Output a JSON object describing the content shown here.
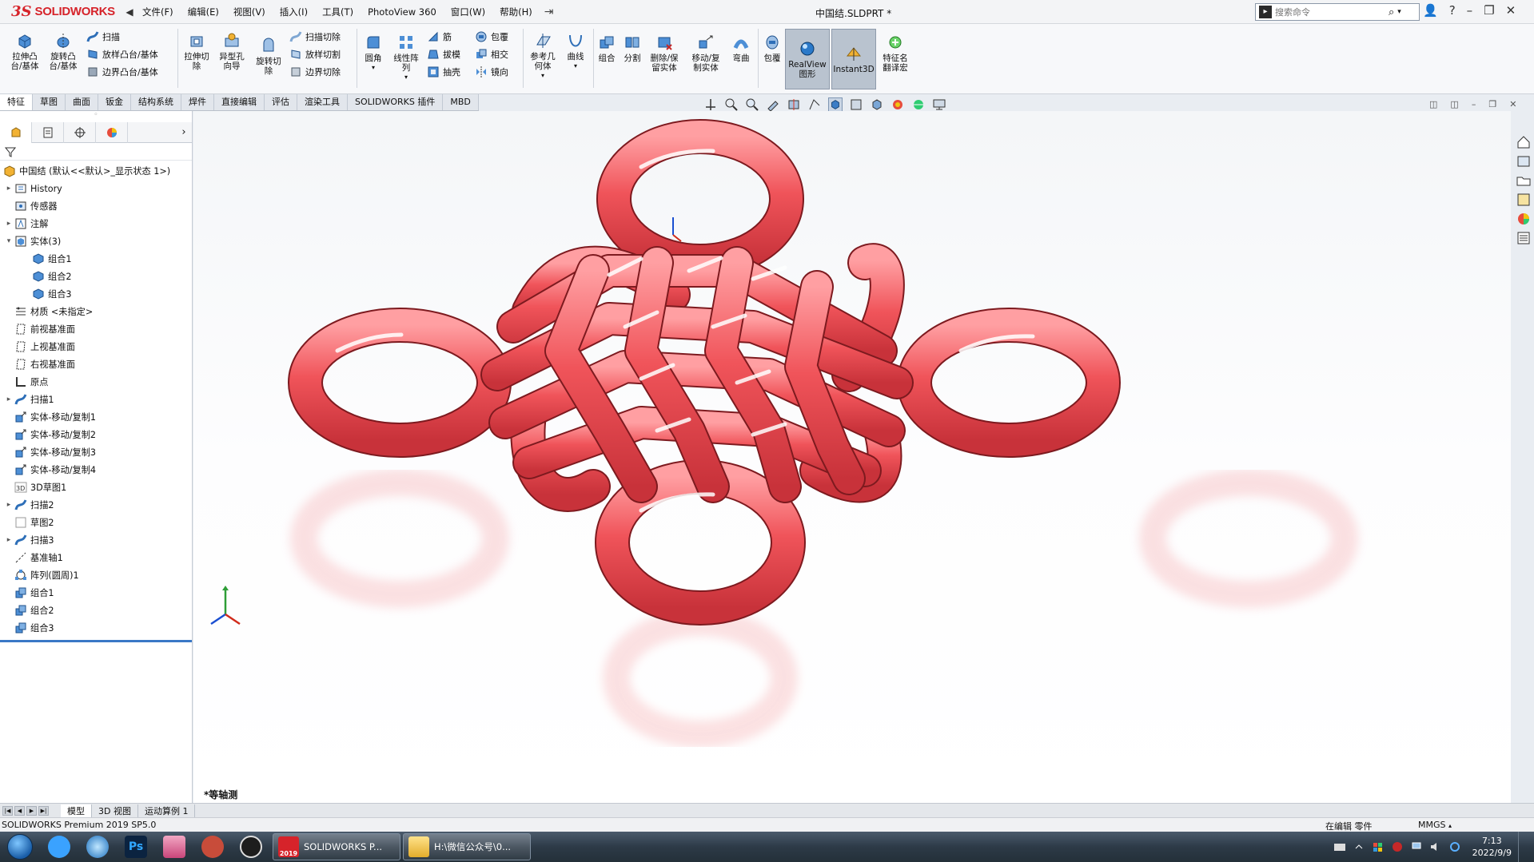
{
  "app": {
    "brand_ds": "3S",
    "brand_name": "SOLIDWORKS",
    "menus": [
      "文件(F)",
      "编辑(E)",
      "视图(V)",
      "插入(I)",
      "工具(T)",
      "PhotoView 360",
      "窗口(W)",
      "帮助(H)"
    ],
    "doc_title": "中国结.SLDPRT *",
    "search_placeholder": "搜索命令"
  },
  "ribbon": {
    "extrude_boss": "拉伸凸\n台/基体",
    "revolve_boss": "旋转凸\n台/基体",
    "sweep": "扫描",
    "loft_boss": "放样凸台/基体",
    "boundary_boss": "边界凸台/基体",
    "extrude_cut": "拉伸切\n除",
    "hole_wizard": "异型孔\n向导",
    "revolve_cut": "旋转切\n除",
    "swept_cut": "扫描切除",
    "lofted_cut": "放样切割",
    "boundary_cut": "边界切除",
    "fillet": "圆角",
    "linear_pattern": "线性阵\n列",
    "rib": "筋",
    "draft": "拔模",
    "shell": "抽壳",
    "wrap": "包覆",
    "intersect": "相交",
    "mirror": "镜向",
    "ref_geometry": "参考几\n何体",
    "curves": "曲线",
    "combine": "组合",
    "split": "分割",
    "delete_keep_body": "删除/保\n留实体",
    "move_copy_body": "移动/复\n制实体",
    "flex": "弯曲",
    "wrap2": "包覆",
    "realview": "RealView\n图形",
    "instant3d": "Instant3D",
    "feature_translate": "特征名\n翻译宏"
  },
  "tabs": [
    "特征",
    "草图",
    "曲面",
    "钣金",
    "结构系统",
    "焊件",
    "直接编辑",
    "评估",
    "渲染工具",
    "SOLIDWORKS 插件",
    "MBD"
  ],
  "tree": {
    "root": "中国结  (默认<<默认>_显示状态 1>)",
    "items": [
      {
        "label": "History",
        "exp": "▸",
        "indent": 0,
        "icon": "history-icon"
      },
      {
        "label": "传感器",
        "exp": "",
        "indent": 0,
        "icon": "sensor-icon"
      },
      {
        "label": "注解",
        "exp": "▸",
        "indent": 0,
        "icon": "annotation-icon"
      },
      {
        "label": "实体(3)",
        "exp": "▾",
        "indent": 0,
        "icon": "solid-bodies-icon"
      },
      {
        "label": "组合1",
        "exp": "",
        "indent": 1,
        "icon": "body-icon"
      },
      {
        "label": "组合2",
        "exp": "",
        "indent": 1,
        "icon": "body-icon"
      },
      {
        "label": "组合3",
        "exp": "",
        "indent": 1,
        "icon": "body-icon"
      },
      {
        "label": "材质 <未指定>",
        "exp": "",
        "indent": 0,
        "icon": "material-icon"
      },
      {
        "label": "前视基准面",
        "exp": "",
        "indent": 0,
        "icon": "plane-icon"
      },
      {
        "label": "上视基准面",
        "exp": "",
        "indent": 0,
        "icon": "plane-icon"
      },
      {
        "label": "右视基准面",
        "exp": "",
        "indent": 0,
        "icon": "plane-icon"
      },
      {
        "label": "原点",
        "exp": "",
        "indent": 0,
        "icon": "origin-icon"
      },
      {
        "label": "扫描1",
        "exp": "▸",
        "indent": 0,
        "icon": "sweep-icon"
      },
      {
        "label": "实体-移动/复制1",
        "exp": "",
        "indent": 0,
        "icon": "move-body-icon"
      },
      {
        "label": "实体-移动/复制2",
        "exp": "",
        "indent": 0,
        "icon": "move-body-icon"
      },
      {
        "label": "实体-移动/复制3",
        "exp": "",
        "indent": 0,
        "icon": "move-body-icon"
      },
      {
        "label": "实体-移动/复制4",
        "exp": "",
        "indent": 0,
        "icon": "move-body-icon"
      },
      {
        "label": "3D草图1",
        "exp": "",
        "indent": 0,
        "icon": "sketch3d-icon"
      },
      {
        "label": "扫描2",
        "exp": "▸",
        "indent": 0,
        "icon": "sweep-icon"
      },
      {
        "label": "草图2",
        "exp": "",
        "indent": 0,
        "icon": "sketch-icon"
      },
      {
        "label": "扫描3",
        "exp": "▸",
        "indent": 0,
        "icon": "sweep-icon"
      },
      {
        "label": "基准轴1",
        "exp": "",
        "indent": 0,
        "icon": "axis-icon"
      },
      {
        "label": "阵列(圆周)1",
        "exp": "",
        "indent": 0,
        "icon": "circular-pattern-icon"
      },
      {
        "label": "组合1",
        "exp": "",
        "indent": 0,
        "icon": "combine-icon"
      },
      {
        "label": "组合2",
        "exp": "",
        "indent": 0,
        "icon": "combine-icon"
      },
      {
        "label": "组合3",
        "exp": "",
        "indent": 0,
        "icon": "combine-icon"
      }
    ]
  },
  "viewport": {
    "view_name": "*等轴测",
    "knot_color": "#f0545a"
  },
  "bottom_tabs": [
    "模型",
    "3D 视图",
    "运动算例 1"
  ],
  "status": {
    "product": "SOLIDWORKS Premium 2019 SP5.0",
    "mode": "在编辑 零件",
    "units": "MMGS"
  },
  "taskbar": {
    "sw_window": "SOLIDWORKS P...",
    "sw_year": "2019",
    "folder_window": "H:\\微信公众号\\0...",
    "time": "7:13",
    "date": "2022/9/9"
  }
}
